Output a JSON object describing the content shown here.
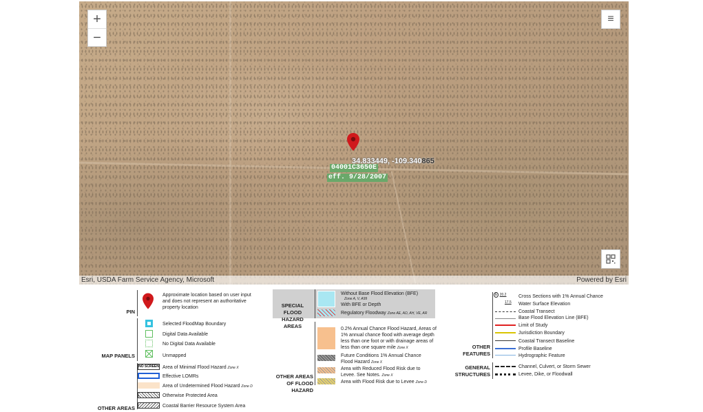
{
  "map": {
    "zoom_in": "+",
    "zoom_out": "−",
    "menu_icon": "≡",
    "attribution_left": "Esri, USDA Farm Service Agency, Microsoft",
    "attribution_right": "Powered by Esri",
    "coord_part1": "34.833449, -109.340",
    "coord_part2": "865",
    "panel_id": "04001C3650E",
    "panel_eff": "eff. 9/28/2007"
  },
  "legend": {
    "pin_cat": "PIN",
    "pin_text": "Approximate location based on user input and does not represent an authoritative property location",
    "map_panels_cat": "MAP PANELS",
    "mp_items": [
      "Selected FloodMap Boundary",
      "Digital Data Available",
      "No Digital Data Available",
      "Unmapped"
    ],
    "other_areas_cat": "OTHER AREAS",
    "no_screen": "NO SCREEN",
    "oa_items": [
      "Area of Minimal Flood Hazard",
      "Effective LOMRs",
      "Area of Undetermined Flood Hazard",
      "Otherwise Protected Area",
      "Coastal Barrier Resource System Area"
    ],
    "oa_zone_x": "Zone X",
    "oa_zone_d": "Zone D",
    "sfha_cat": "SPECIAL FLOOD HAZARD AREAS",
    "sfha_items": [
      "Without Base Flood Elevation (BFE)",
      "Zone A, V, A99",
      "With BFE or Depth",
      "Regulatory Floodway"
    ],
    "sfha_zones2": "Zone AE, AO, AH, VE, AR",
    "oafh_cat": "OTHER AREAS OF FLOOD HAZARD",
    "oafh_items": [
      "0.2% Annual Chance Flood Hazard, Areas of 1% annual chance flood with average depth less than one foot or with drainage areas of less than one square mile",
      "Future Conditions 1% Annual Chance Flood Hazard",
      "Area with Reduced Flood Risk due to Levee. See Notes.",
      "Area with Flood Risk due to Levee"
    ],
    "zone_x": "Zone X",
    "zone_d": "Zone D",
    "of_cat": "OTHER FEATURES",
    "of_items": [
      "Cross Sections with 1% Annual Chance",
      "Water Surface Elevation",
      "Coastal Transect",
      "Base Flood Elevation Line (BFE)",
      "Limit of Study",
      "Jurisdiction Boundary",
      "Coastal Transect Baseline",
      "Profile Baseline",
      "Hydrographic Feature"
    ],
    "of_num1": "20.2",
    "of_num2": "17.5",
    "gs_cat": "GENERAL STRUCTURES",
    "gs_items": [
      "Channel, Culvert, or Storm Sewer",
      "Levee, Dike, or Floodwall"
    ],
    "colors": {
      "pin": "#d0191c",
      "panel_green": "#6aa86a",
      "lomr_blue": "#1f5fd6",
      "limit_red": "#e02020",
      "jurisdiction_yellow": "#d9c400",
      "profile_blue": "#3b6fd4",
      "sfha_cyan": "#a9e7f2",
      "xshade_orange": "#f7c08e"
    }
  }
}
